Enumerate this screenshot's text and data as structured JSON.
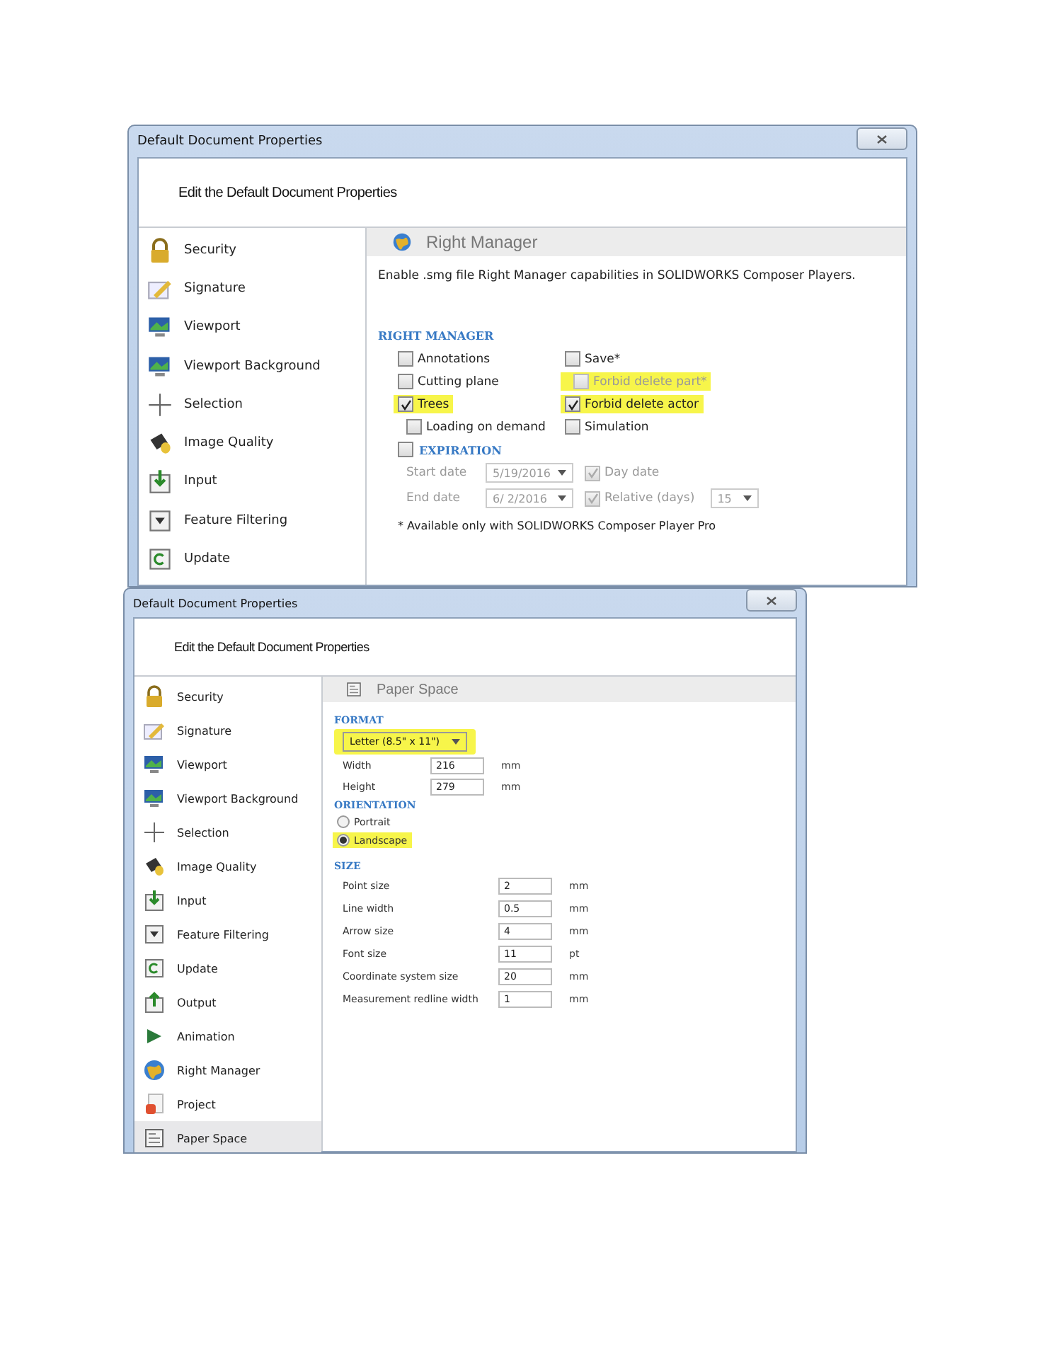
{
  "windows": [
    {
      "kind": "right_manager",
      "title": "Default Document Properties",
      "header": "Edit the Default Document Properties",
      "sidebar": [
        {
          "label": "Security",
          "selected": false
        },
        {
          "label": "Signature",
          "selected": false
        },
        {
          "label": "Viewport",
          "selected": false
        },
        {
          "label": "Viewport Background",
          "selected": false
        },
        {
          "label": "Selection",
          "selected": false
        },
        {
          "label": "Image Quality",
          "selected": false
        },
        {
          "label": "Input",
          "selected": false
        },
        {
          "label": "Feature Filtering",
          "selected": false
        },
        {
          "label": "Update",
          "selected": false
        }
      ],
      "panel": {
        "title": "Right Manager",
        "description": "Enable .smg file Right Manager capabilities in SOLIDWORKS Composer Players.",
        "section": "RIGHT MANAGER",
        "options": [
          {
            "label": "Annotations",
            "checked": false,
            "disabled": false,
            "highlighted": false,
            "indent": false
          },
          {
            "label": "Save*",
            "checked": false,
            "disabled": false,
            "highlighted": false,
            "indent": false
          },
          {
            "label": "Cutting plane",
            "checked": false,
            "disabled": false,
            "highlighted": false,
            "indent": false
          },
          {
            "label": "Forbid delete part*",
            "checked": false,
            "disabled": true,
            "highlighted": true,
            "indent": true
          },
          {
            "label": "Trees",
            "checked": true,
            "disabled": false,
            "highlighted": true,
            "indent": false
          },
          {
            "label": "Forbid delete actor",
            "checked": true,
            "disabled": false,
            "highlighted": true,
            "indent": false
          },
          {
            "label": "Loading on demand",
            "checked": false,
            "disabled": false,
            "highlighted": false,
            "indent": true
          },
          {
            "label": "Simulation",
            "checked": false,
            "disabled": false,
            "highlighted": false,
            "indent": false
          }
        ],
        "expiration": {
          "label": "EXPIRATION",
          "checked": false,
          "rows": [
            {
              "label": "Start date",
              "value": "5/19/2016",
              "option": {
                "label": "Day date",
                "checked": true
              }
            },
            {
              "label": "End date",
              "value": "6/  2/2016",
              "option": {
                "label": "Relative (days)",
                "checked": true
              },
              "extra": "15"
            }
          ]
        },
        "footnote": "* Available only with SOLIDWORKS Composer Player Pro"
      }
    },
    {
      "kind": "paper_space",
      "title": "Default Document Properties",
      "header": "Edit the Default Document Properties",
      "sidebar": [
        {
          "label": "Security",
          "selected": false
        },
        {
          "label": "Signature",
          "selected": false
        },
        {
          "label": "Viewport",
          "selected": false
        },
        {
          "label": "Viewport Background",
          "selected": false
        },
        {
          "label": "Selection",
          "selected": false
        },
        {
          "label": "Image Quality",
          "selected": false
        },
        {
          "label": "Input",
          "selected": false
        },
        {
          "label": "Feature Filtering",
          "selected": false
        },
        {
          "label": "Update",
          "selected": false
        },
        {
          "label": "Output",
          "selected": false
        },
        {
          "label": "Animation",
          "selected": false
        },
        {
          "label": "Right Manager",
          "selected": false
        },
        {
          "label": "Project",
          "selected": false
        },
        {
          "label": "Paper Space",
          "selected": true
        }
      ],
      "panel": {
        "title": "Paper Space",
        "format": {
          "heading": "FORMAT",
          "value": "Letter (8.5\" x 11\")",
          "highlighted": true,
          "fields": [
            {
              "label": "Width",
              "value": "216",
              "unit": "mm"
            },
            {
              "label": "Height",
              "value": "279",
              "unit": "mm"
            }
          ]
        },
        "orientation": {
          "heading": "ORIENTATION",
          "options": [
            {
              "label": "Portrait",
              "selected": false,
              "highlighted": false
            },
            {
              "label": "Landscape",
              "selected": true,
              "highlighted": true
            }
          ]
        },
        "size": {
          "heading": "SIZE",
          "fields": [
            {
              "label": "Point size",
              "value": "2",
              "unit": "mm"
            },
            {
              "label": "Line width",
              "value": "0.5",
              "unit": "mm"
            },
            {
              "label": "Arrow size",
              "value": "4",
              "unit": "mm"
            },
            {
              "label": "Font size",
              "value": "11",
              "unit": "pt"
            },
            {
              "label": "Coordinate system size",
              "value": "20",
              "unit": "mm"
            },
            {
              "label": "Measurement redline width",
              "value": "1",
              "unit": "mm"
            }
          ]
        }
      }
    }
  ]
}
